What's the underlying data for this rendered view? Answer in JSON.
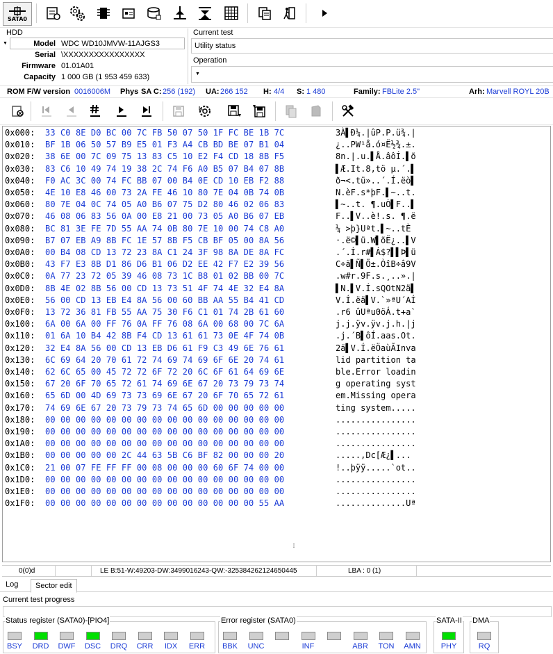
{
  "toolbar": {
    "sata_label": "SATA0",
    "icons": [
      "sata-connect-icon",
      "drive-info-icon",
      "settings-icon",
      "chip-icon",
      "sector-icon",
      "database-icon",
      "tools-icon",
      "test-icon",
      "grid-icon",
      "copy-icon",
      "exit-icon",
      "play-icon"
    ]
  },
  "hdd": {
    "group_title": "HDD",
    "model_label": "Model",
    "model_value": "WDC WD10JMVW-11AJGS3",
    "serial_label": "Serial",
    "serial_value": "\\XXXXXXXXXXXXXXXX",
    "firmware_label": "Firmware",
    "firmware_value": "01.01A01",
    "capacity_label": "Capacity",
    "capacity_value": "1 000 GB (1 953 459 633)"
  },
  "current_test": {
    "title": "Current test",
    "value": "Utility status"
  },
  "operation": {
    "title": "Operation",
    "value": ""
  },
  "rom_line": {
    "rom_label": "ROM F/W version",
    "rom_value": "0016006M",
    "phys_label": "Phys",
    "sac_label": "SA C:",
    "sac_value": "256 (192)",
    "ua_label": "UA:",
    "ua_value": "266 152",
    "h_label": "H:",
    "h_value": "4/4",
    "s_label": "S:",
    "s_value": "1 480",
    "family_label": "Family:",
    "family_value": "FBLite 2.5\"",
    "arh_label": "Arh:",
    "arh_value": "Marvell ROYL 20B"
  },
  "hex": {
    "rows": [
      {
        "off": "0x000:",
        "bytes": "33 C0 8E D0 BC 00 7C FB 50 07 50 1F FC BE 1B 7C",
        "ascii": "3À▌Ð¼.|ûP.P.ü¾.|"
      },
      {
        "off": "0x010:",
        "bytes": "BF 1B 06 50 57 B9 E5 01 F3 A4 CB BD BE 07 B1 04",
        "ascii": "¿..PW¹å.ó¤Ë½¾.±."
      },
      {
        "off": "0x020:",
        "bytes": "38 6E 00 7C 09 75 13 83 C5 10 E2 F4 CD 18 8B F5",
        "ascii": "8n.|.u.▌Å.âôÍ.▌õ"
      },
      {
        "off": "0x030:",
        "bytes": "83 C6 10 49 74 19 38 2C 74 F6 A0 B5 07 B4 07 8B",
        "ascii": "▌Æ.It.8,tö µ.´.▌"
      },
      {
        "off": "0x040:",
        "bytes": "F0 AC 3C 00 74 FC BB 07 00 B4 0E CD 10 EB F2 88",
        "ascii": "ð¬<.tü»..´.Í.ëò▌"
      },
      {
        "off": "0x050:",
        "bytes": "4E 10 E8 46 00 73 2A FE 46 10 80 7E 04 0B 74 0B",
        "ascii": "N.èF.s*þF.▌~..t."
      },
      {
        "off": "0x060:",
        "bytes": "80 7E 04 0C 74 05 A0 B6 07 75 D2 80 46 02 06 83",
        "ascii": "▌~..t. ¶.uÒ▌F..▌"
      },
      {
        "off": "0x070:",
        "bytes": "46 08 06 83 56 0A 00 E8 21 00 73 05 A0 B6 07 EB",
        "ascii": "F..▌V..è!.s. ¶.ë"
      },
      {
        "off": "0x080:",
        "bytes": "BC 81 3E FE 7D 55 AA 74 0B 80 7E 10 00 74 C8 A0",
        "ascii": "¼ >þ}Uªt.▌~..tÈ "
      },
      {
        "off": "0x090:",
        "bytes": "B7 07 EB A9 8B FC 1E 57 8B F5 CB BF 05 00 8A 56",
        "ascii": "·.ë©▌ü.W▌õË¿..▌V"
      },
      {
        "off": "0x0A0:",
        "bytes": "00 B4 08 CD 13 72 23 8A C1 24 3F 98 8A DE 8A FC",
        "ascii": ".´.Í.r#▌Á$?▌▌Þ▌ü"
      },
      {
        "off": "0x0B0:",
        "bytes": "43 F7 E3 8B D1 86 D6 B1 06 D2 EE 42 F7 E2 39 56",
        "ascii": "C÷ã▌Ñ▌Ö±.ÒîB÷â9V"
      },
      {
        "off": "0x0C0:",
        "bytes": "0A 77 23 72 05 39 46 08 73 1C B8 01 02 BB 00 7C",
        "ascii": ".w#r.9F.s.¸..».|"
      },
      {
        "off": "0x0D0:",
        "bytes": "8B 4E 02 8B 56 00 CD 13 73 51 4F 74 4E 32 E4 8A",
        "ascii": "▌N.▌V.Í.sQOtN2ä▌"
      },
      {
        "off": "0x0E0:",
        "bytes": "56 00 CD 13 EB E4 8A 56 00 60 BB AA 55 B4 41 CD",
        "ascii": "V.Í.ëä▌V.`»ªU´AÍ"
      },
      {
        "off": "0x0F0:",
        "bytes": "13 72 36 81 FB 55 AA 75 30 F6 C1 01 74 2B 61 60",
        "ascii": ".r6 ûUªu0öÁ.t+a`"
      },
      {
        "off": "0x100:",
        "bytes": "6A 00 6A 00 FF 76 0A FF 76 08 6A 00 68 00 7C 6A",
        "ascii": "j.j.ÿv.ÿv.j.h.|j"
      },
      {
        "off": "0x110:",
        "bytes": "01 6A 10 B4 42 8B F4 CD 13 61 61 73 0E 4F 74 0B",
        "ascii": ".j.´B▌ôÍ.aas.Ot."
      },
      {
        "off": "0x120:",
        "bytes": "32 E4 8A 56 00 CD 13 EB D6 61 F9 C3 49 6E 76 61",
        "ascii": "2ä▌V.Í.ëÖaùÃInva"
      },
      {
        "off": "0x130:",
        "bytes": "6C 69 64 20 70 61 72 74 69 74 69 6F 6E 20 74 61",
        "ascii": "lid partition ta"
      },
      {
        "off": "0x140:",
        "bytes": "62 6C 65 00 45 72 72 6F 72 20 6C 6F 61 64 69 6E",
        "ascii": "ble.Error loadin"
      },
      {
        "off": "0x150:",
        "bytes": "67 20 6F 70 65 72 61 74 69 6E 67 20 73 79 73 74",
        "ascii": "g operating syst"
      },
      {
        "off": "0x160:",
        "bytes": "65 6D 00 4D 69 73 73 69 6E 67 20 6F 70 65 72 61",
        "ascii": "em.Missing opera"
      },
      {
        "off": "0x170:",
        "bytes": "74 69 6E 67 20 73 79 73 74 65 6D 00 00 00 00 00",
        "ascii": "ting system....."
      },
      {
        "off": "0x180:",
        "bytes": "00 00 00 00 00 00 00 00 00 00 00 00 00 00 00 00",
        "ascii": "................"
      },
      {
        "off": "0x190:",
        "bytes": "00 00 00 00 00 00 00 00 00 00 00 00 00 00 00 00",
        "ascii": "................"
      },
      {
        "off": "0x1A0:",
        "bytes": "00 00 00 00 00 00 00 00 00 00 00 00 00 00 00 00",
        "ascii": "................"
      },
      {
        "off": "0x1B0:",
        "bytes": "00 00 00 00 00 2C 44 63 5B C6 BF 82 00 00 00 20",
        "ascii": ".....,Dc[Æ¿▌... "
      },
      {
        "off": "0x1C0:",
        "bytes": "21 00 07 FE FF FF 00 08 00 00 00 60 6F 74 00 00",
        "ascii": "!..þÿÿ.....`ot.."
      },
      {
        "off": "0x1D0:",
        "bytes": "00 00 00 00 00 00 00 00 00 00 00 00 00 00 00 00",
        "ascii": "................"
      },
      {
        "off": "0x1E0:",
        "bytes": "00 00 00 00 00 00 00 00 00 00 00 00 00 00 00 00",
        "ascii": "................"
      },
      {
        "off": "0x1F0:",
        "bytes": "00 00 00 00 00 00 00 00 00 00 00 00 00 00 55 AA",
        "ascii": "..............Uª"
      }
    ]
  },
  "statusbar": {
    "pos": "0(0)d",
    "le": "LE B:51-W:49203-DW:3499016243-QW:-325384262124650445",
    "lba": "LBA : 0 (1)"
  },
  "tabs": {
    "log": "Log",
    "sector_edit": "Sector edit"
  },
  "progress": {
    "label": "Current test progress",
    "percent": 0
  },
  "status_register": {
    "title": "Status register (SATA0)-[PIO4]",
    "leds": [
      {
        "label": "BSY",
        "on": false
      },
      {
        "label": "DRD",
        "on": true
      },
      {
        "label": "DWF",
        "on": false
      },
      {
        "label": "DSC",
        "on": true
      },
      {
        "label": "DRQ",
        "on": false
      },
      {
        "label": "CRR",
        "on": false
      },
      {
        "label": "IDX",
        "on": false
      },
      {
        "label": "ERR",
        "on": false
      }
    ]
  },
  "error_register": {
    "title": "Error register (SATA0)",
    "leds": [
      {
        "label": "BBK",
        "on": false
      },
      {
        "label": "UNC",
        "on": false
      },
      {
        "label": "",
        "on": false
      },
      {
        "label": "INF",
        "on": false
      },
      {
        "label": "",
        "on": false
      },
      {
        "label": "ABR",
        "on": false
      },
      {
        "label": "TON",
        "on": false
      },
      {
        "label": "AMN",
        "on": false
      }
    ]
  },
  "sata2": {
    "title": "SATA-II",
    "label": "PHY",
    "on": true
  },
  "dma": {
    "title": "DMA",
    "label": "RQ",
    "on": false
  },
  "colors": {
    "blue_value": "#1a3bd6",
    "led_on": "#00e000",
    "led_off": "#cfcfcf"
  }
}
